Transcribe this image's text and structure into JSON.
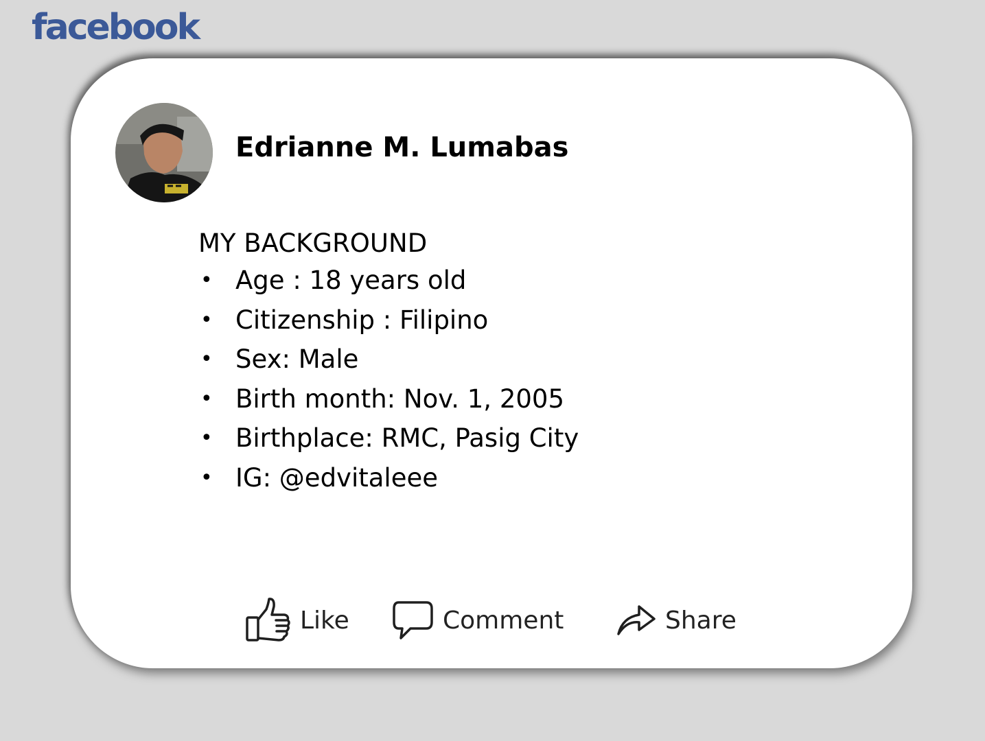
{
  "brand": {
    "logo_text": "facebook",
    "color": "#3b5998"
  },
  "post": {
    "author_name": "Edrianne M. Lumabas",
    "section_title": "MY BACKGROUND",
    "details": [
      "Age : 18 years old",
      "Citizenship : Filipino",
      "Sex: Male",
      "Birth month: Nov. 1, 2005",
      "Birthplace: RMC, Pasig City",
      "IG: @edvitaleee"
    ]
  },
  "actions": {
    "like": {
      "label": "Like",
      "icon": "thumbs-up-icon"
    },
    "comment": {
      "label": "Comment",
      "icon": "speech-bubble-icon"
    },
    "share": {
      "label": "Share",
      "icon": "share-arrow-icon"
    }
  },
  "colors": {
    "background": "#d9d9d9",
    "card": "#ffffff",
    "text": "#000000"
  }
}
